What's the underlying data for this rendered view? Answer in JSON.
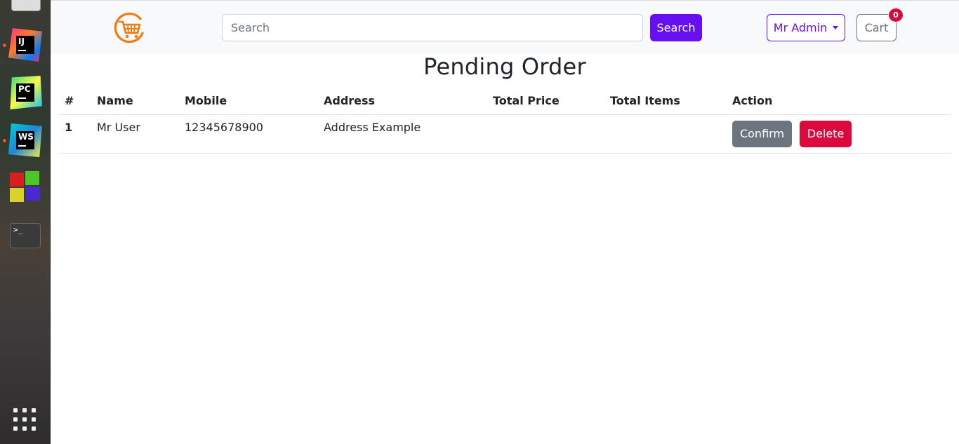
{
  "dock": {
    "apps": [
      {
        "icon": "intellij-idea-icon",
        "label": "IJ"
      },
      {
        "icon": "pycharm-icon",
        "label": "PC"
      },
      {
        "icon": "webstorm-icon",
        "label": "WS"
      },
      {
        "icon": "cubes-app-icon"
      },
      {
        "icon": "terminal-icon",
        "label": ">_"
      }
    ]
  },
  "navbar": {
    "search_placeholder": "Search",
    "search_button": "Search",
    "user_menu": "Mr Admin",
    "cart_label": "Cart",
    "cart_count": "0"
  },
  "page": {
    "title": "Pending Order"
  },
  "table": {
    "headers": [
      "#",
      "Name",
      "Mobile",
      "Address",
      "Total Price",
      "Total Items",
      "Action"
    ],
    "rows": [
      {
        "index": "1",
        "name": "Mr User",
        "mobile": "12345678900",
        "address": "Address Example",
        "total_price": "",
        "total_items": ""
      }
    ],
    "confirm_label": "Confirm",
    "delete_label": "Delete"
  },
  "colors": {
    "primary": "#6610f2",
    "danger": "#dc0a3c",
    "secondary": "#6c757d",
    "logo": "#f07c0f"
  }
}
